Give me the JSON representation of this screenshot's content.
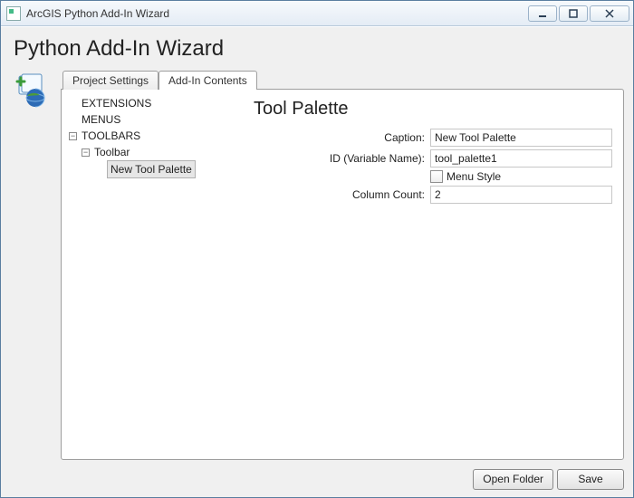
{
  "window": {
    "title": "ArcGIS Python Add-In Wizard"
  },
  "heading": "Python Add-In Wizard",
  "tabs": {
    "project_settings": "Project Settings",
    "addin_contents": "Add-In Contents",
    "active": "addin_contents"
  },
  "tree": {
    "extensions": "EXTENSIONS",
    "menus": "MENUS",
    "toolbars": "TOOLBARS",
    "toolbar": "Toolbar",
    "new_tool_palette": "New Tool Palette"
  },
  "form": {
    "title": "Tool Palette",
    "caption_label": "Caption:",
    "caption_value": "New Tool Palette",
    "id_label": "ID (Variable Name):",
    "id_value": "tool_palette1",
    "menu_style_label": "Menu Style",
    "menu_style_checked": false,
    "column_count_label": "Column Count:",
    "column_count_value": "2"
  },
  "buttons": {
    "open_folder": "Open Folder",
    "save": "Save"
  }
}
